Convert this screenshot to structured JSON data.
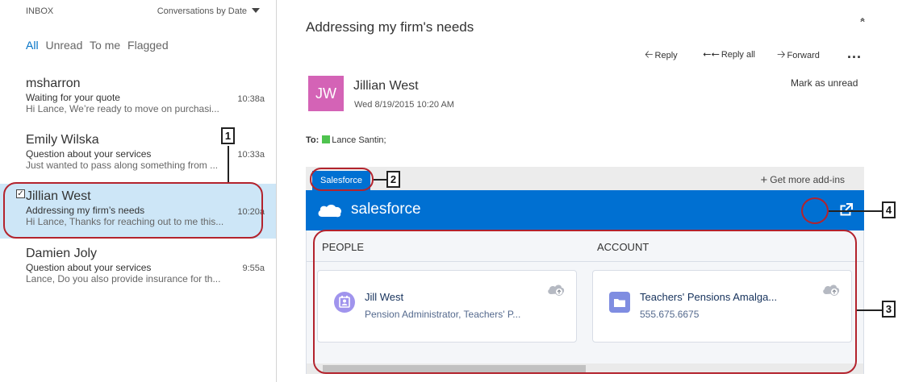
{
  "inbox": {
    "header": "INBOX",
    "sort_label": "Conversations by Date",
    "filters": [
      "All",
      "Unread",
      "To me",
      "Flagged"
    ],
    "messages": [
      {
        "sender": "msharron",
        "subject": "Waiting for your quote",
        "time": "10:38a",
        "preview": "Hi Lance,  We’re ready to move on purchasi..."
      },
      {
        "sender": "Emily Wilska",
        "subject": "Question about your services",
        "time": "10:33a",
        "preview": "Just wanted to pass along something from ..."
      },
      {
        "sender": "Jillian West",
        "subject": "Addressing my firm’s needs",
        "time": "10:20a",
        "preview": "Hi Lance,  Thanks for reaching out to me this..."
      },
      {
        "sender": "Damien Joly",
        "subject": "Question about your services",
        "time": "9:55a",
        "preview": "Lance,  Do you also provide insurance for th..."
      }
    ]
  },
  "reading": {
    "subject": "Addressing my firm's needs",
    "actions": {
      "reply": "Reply",
      "reply_all": "Reply all",
      "forward": "Forward"
    },
    "more": "...",
    "avatar_initials": "JW",
    "from_name": "Jillian West",
    "date": "Wed 8/19/2015 10:20 AM",
    "mark_unread": "Mark as unread",
    "to_label": "To:",
    "to_name": "Lance Santin;"
  },
  "addin": {
    "tab_label": "Salesforce",
    "get_more": "Get more add-ins",
    "logo_text": "salesforce",
    "people_header": "PEOPLE",
    "account_header": "ACCOUNT",
    "person": {
      "name": "Jill West",
      "title": "Pension Administrator, Teachers' P..."
    },
    "account": {
      "name": "Teachers' Pensions Amalga...",
      "phone": "555.675.6675"
    }
  },
  "callouts": [
    "1",
    "2",
    "3",
    "4"
  ],
  "colors": {
    "accent": "#0072c6",
    "salesforce_blue": "#0070d2",
    "avatar": "#d463b6",
    "selected_row": "#cde6f7",
    "callout_ring": "#b3232d",
    "presence": "#4fc34f",
    "contact_icon": "#a094ed",
    "account_icon": "#7f8de1"
  },
  "icons": [
    "sort-caret-icon",
    "checkbox-icon",
    "collapse-icon",
    "reply-icon",
    "reply-all-icon",
    "forward-icon",
    "more-icon",
    "presence-icon",
    "plus-icon",
    "salesforce-cloud-icon",
    "popout-icon",
    "contact-icon",
    "account-icon",
    "cloud-upload-icon"
  ]
}
